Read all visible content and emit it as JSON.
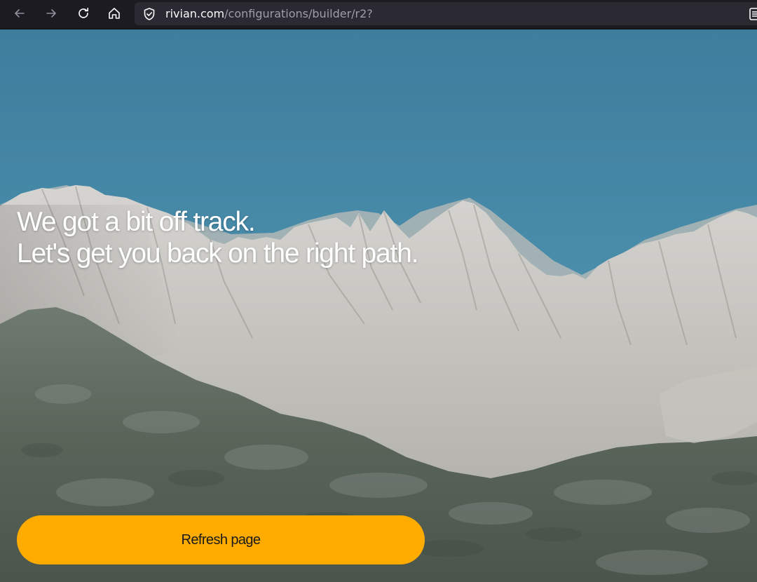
{
  "browser": {
    "url_host": "rivian.com",
    "url_path": "/configurations/builder/r2?",
    "icons": {
      "back": "arrow-left-icon",
      "forward": "arrow-right-icon",
      "reload": "reload-icon",
      "home": "home-icon",
      "security": "shield-icon",
      "reader": "reader-view-icon"
    }
  },
  "page": {
    "headline_line1": "We got a bit off track.",
    "headline_line2": "Let's get you back on the right path.",
    "refresh_label": "Refresh page",
    "background_image": "mountain-range-photo"
  },
  "colors": {
    "accent_button": "#ffab00",
    "sky": "#468aa8",
    "browser_chrome": "#1c1b22"
  }
}
